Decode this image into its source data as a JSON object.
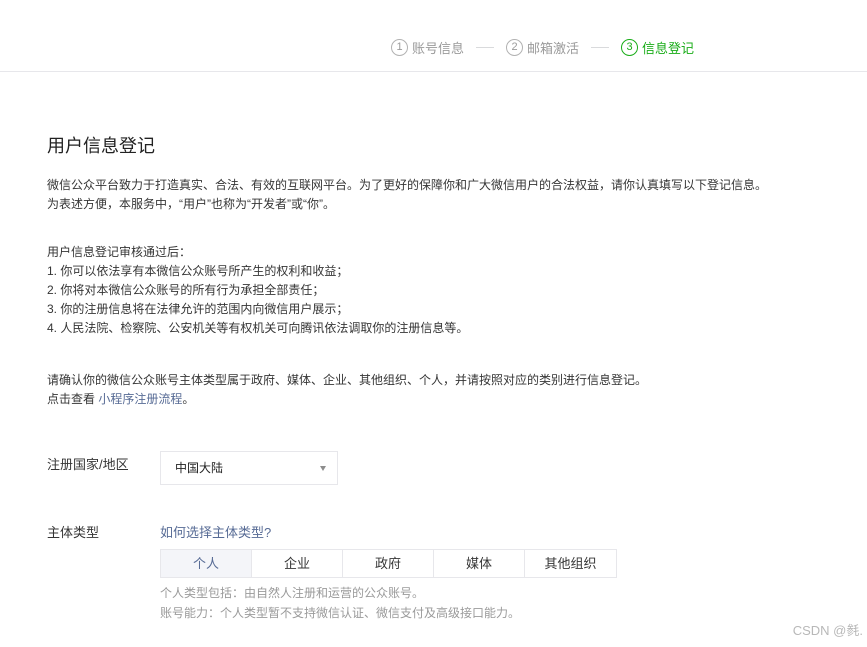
{
  "steps": [
    {
      "num": "1",
      "label": "账号信息",
      "active": false
    },
    {
      "num": "2",
      "label": "邮箱激活",
      "active": false
    },
    {
      "num": "3",
      "label": "信息登记",
      "active": true
    }
  ],
  "page_title": "用户信息登记",
  "intro": {
    "line1": "微信公众平台致力于打造真实、合法、有效的互联网平台。为了更好的保障你和广大微信用户的合法权益，请你认真填写以下登记信息。",
    "line2": "为表述方便，本服务中，“用户”也称为“开发者”或“你”。"
  },
  "review": {
    "heading": "用户信息登记审核通过后：",
    "items": [
      "1. 你可以依法享有本微信公众账号所产生的权利和收益；",
      "2. 你将对本微信公众账号的所有行为承担全部责任；",
      "3. 你的注册信息将在法律允许的范围内向微信用户展示；",
      "4. 人民法院、检察院、公安机关等有权机关可向腾讯依法调取你的注册信息等。"
    ]
  },
  "confirm": {
    "line1": "请确认你的微信公众账号主体类型属于政府、媒体、企业、其他组织、个人，并请按照对应的类别进行信息登记。",
    "line2_prefix": "点击查看",
    "line2_link": "小程序注册流程",
    "line2_suffix": "。"
  },
  "country": {
    "label": "注册国家/地区",
    "value": "中国大陆"
  },
  "subject": {
    "label": "主体类型",
    "help_link": "如何选择主体类型?",
    "tabs": [
      "个人",
      "企业",
      "政府",
      "媒体",
      "其他组织"
    ],
    "active_index": 0,
    "hint1": "个人类型包括：由自然人注册和运营的公众账号。",
    "hint2": "账号能力：个人类型暂不支持微信认证、微信支付及高级接口能力。"
  },
  "watermark": "CSDN @毵.",
  "colors": {
    "accent_green": "#1aad19",
    "link_blue": "#576b95",
    "muted": "#9a9a9a"
  }
}
